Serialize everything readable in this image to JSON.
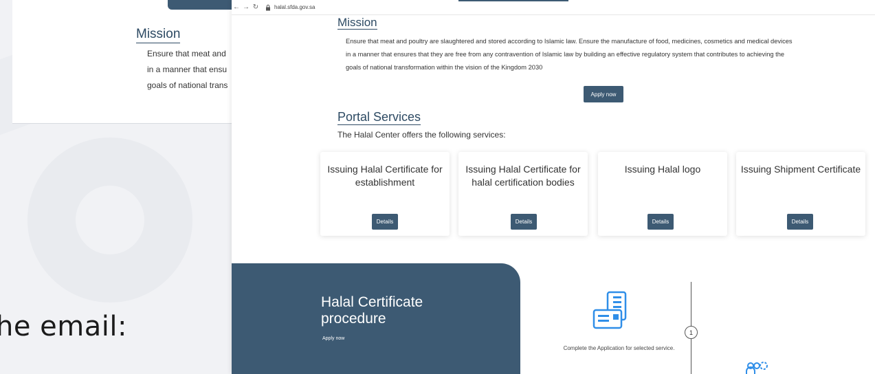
{
  "slide": {
    "partial_text": "he email:"
  },
  "back_screenshot": {
    "mission_title": "Mission",
    "lines": [
      "Ensure that meat and",
      "in a manner that ensu",
      "goals of national trans"
    ]
  },
  "browser": {
    "back_icon": "back-arrow-icon",
    "forward_icon": "forward-arrow-icon",
    "reload_icon": "reload-icon",
    "lock_icon": "lock-icon",
    "url": "halal.sfda.gov.sa"
  },
  "mission": {
    "title": "Mission",
    "lines": [
      "Ensure that meat and poultry are slaughtered and stored according to Islamic law. Ensure the manufacture of food, medicines, cosmetics and medical devices",
      "in a manner that ensures that they are free from any contravention of Islamic law by building an effective regulatory system that contributes to achieving the",
      "goals of national transformation within the vision of the Kingdom 2030"
    ],
    "apply_label": "Apply now"
  },
  "portal": {
    "title": "Portal Services",
    "subtitle": "The Halal Center offers the following services:",
    "cards": [
      {
        "title": "Issuing Halal Certificate for establishment",
        "button": "Details"
      },
      {
        "title": "Issuing Halal Certificate for halal certification bodies",
        "button": "Details"
      },
      {
        "title": "Issuing Halal logo",
        "button": "Details"
      },
      {
        "title": "Issuing Shipment Certificate",
        "button": "Details"
      }
    ]
  },
  "procedure": {
    "title_line1": "Halal Certificate",
    "title_line2": "procedure",
    "apply_label": "Apply now",
    "step1_number": "1",
    "step1_text": "Complete the Application for selected service.",
    "step1_icon": "application-form-icon",
    "step2_icon": "people-gears-icon"
  },
  "colors": {
    "accent": "#3d5a73",
    "icon_blue": "#2f8ee8"
  }
}
